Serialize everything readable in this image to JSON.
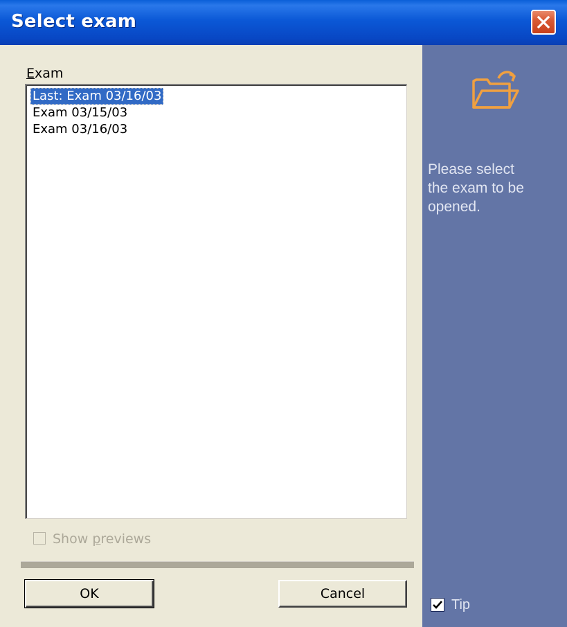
{
  "window": {
    "title": "Select exam"
  },
  "exam_list": {
    "label_accel": "E",
    "label_rest": "xam",
    "items": [
      {
        "label": "Last: Exam 03/16/03",
        "selected": true
      },
      {
        "label": "Exam 03/15/03",
        "selected": false
      },
      {
        "label": "Exam 03/16/03",
        "selected": false
      }
    ]
  },
  "show_previews": {
    "label_pre": "Show ",
    "label_accel": "p",
    "label_post": "reviews",
    "checked": false,
    "enabled": false
  },
  "buttons": {
    "ok": "OK",
    "cancel": "Cancel"
  },
  "tip_panel": {
    "icon": "open-folder-icon",
    "message": "Please select\nthe exam to be\nopened.",
    "tip_label": "Tip",
    "tip_checked": true
  },
  "colors": {
    "titlebar": "#0b58d6",
    "dialog_bg": "#ece9d8",
    "tip_panel_bg": "#6375a6",
    "selection": "#316ac5",
    "folder_icon": "#f0a040"
  }
}
